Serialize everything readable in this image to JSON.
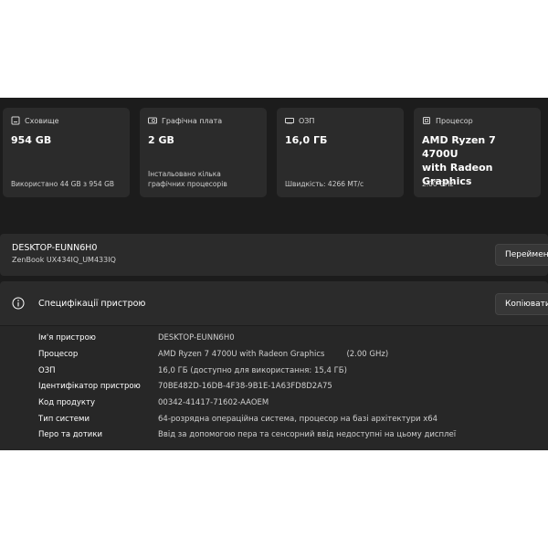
{
  "cards": [
    {
      "icon": "storage-icon",
      "title": "Сховище",
      "value_lines": [
        "954 GB"
      ],
      "sub_lines": [
        "Використано 44 GB з 954 GB"
      ]
    },
    {
      "icon": "graphics-card-icon",
      "title": "Графічна плата",
      "value_lines": [
        "2 GB"
      ],
      "sub_lines": [
        "Інстальовано кілька",
        "графічних процесорів"
      ]
    },
    {
      "icon": "ram-icon",
      "title": "ОЗП",
      "value_lines": [
        "16,0 ГБ"
      ],
      "sub_lines": [
        "Швидкість: 4266 МТ/с"
      ]
    },
    {
      "icon": "processor-icon",
      "title": "Процесор",
      "value_lines": [
        "AMD Ryzen 7 4700U",
        "with Radeon Graphics"
      ],
      "sub_lines": [
        "2.00 GHz"
      ]
    }
  ],
  "device": {
    "name": "DESKTOP-EUNN6H0",
    "model": "ZenBook UX434IQ_UM433IQ",
    "rename_label": "Перейменувати цей ПК"
  },
  "specs": {
    "title": "Специфікації пристрою",
    "copy_label": "Копіювати",
    "rows": [
      {
        "label": "Ім'я пристрою",
        "value": "DESKTOP-EUNN6H0",
        "extra": ""
      },
      {
        "label": "Процесор",
        "value": "AMD Ryzen 7 4700U with Radeon Graphics",
        "extra": "(2.00 GHz)"
      },
      {
        "label": "ОЗП",
        "value": "16,0 ГБ (доступно для використання: 15,4 ГБ)",
        "extra": ""
      },
      {
        "label": "Ідентифікатор пристрою",
        "value": "70BE482D-16DB-4F38-9B1E-1A63FD8D2A75",
        "extra": ""
      },
      {
        "label": "Код продукту",
        "value": "00342-41417-71602-AAOEM",
        "extra": ""
      },
      {
        "label": "Тип системи",
        "value": "64-розрядна операційна система, процесор на базі архітектури x64",
        "extra": ""
      },
      {
        "label": "Перо та дотики",
        "value": "Ввід за допомогою пера та сенсорний ввід недоступні на цьому дисплеї",
        "extra": ""
      }
    ]
  }
}
